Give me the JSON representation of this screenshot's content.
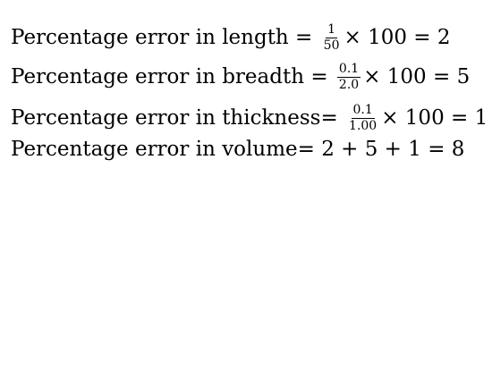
{
  "lines": [
    {
      "label": "Percentage error in length",
      "eq_before": " = ",
      "frac_num": "1",
      "frac_den": "50",
      "rest": "× 100 = 2"
    },
    {
      "label": "Percentage error in breadth",
      "eq_before": " = ",
      "frac_num": "0.1",
      "frac_den": "2.0",
      "rest": "× 100 = 5"
    },
    {
      "label": "Percentage error in thickness",
      "eq_before": "= ",
      "frac_num": "0.1",
      "frac_den": "1.00",
      "rest": "× 100 = 1"
    },
    {
      "label": "Percentage error in volume",
      "expression": "= 2 + 5 + 1 = 8"
    }
  ]
}
